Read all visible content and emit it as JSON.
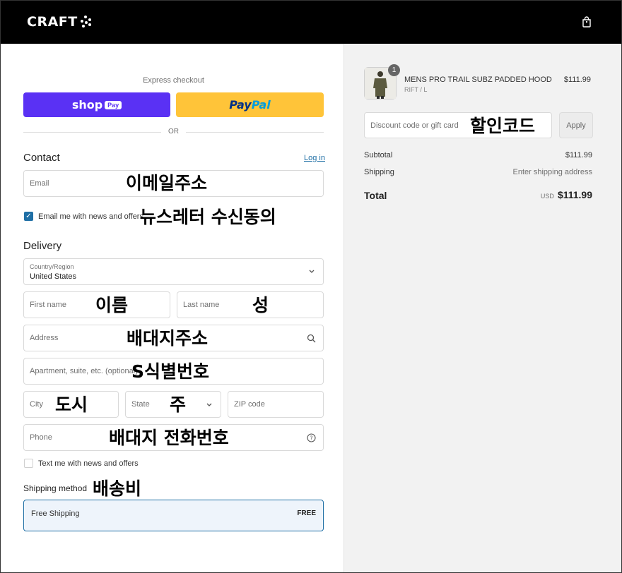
{
  "header": {
    "logo": "CRAFT",
    "bag_icon": "shopping-bag-icon"
  },
  "express": {
    "label": "Express checkout",
    "shop_pay": {
      "shop": "shop",
      "pay": "Pay",
      "color": "#5a31f4"
    },
    "paypal": {
      "p1": "Pay",
      "p2": "Pal",
      "color": "#ffc439"
    },
    "or": "OR"
  },
  "contact": {
    "title": "Contact",
    "login": "Log in",
    "email_placeholder": "Email",
    "email_note": "이메일주소",
    "newsletter_label": "Email me with news and offers",
    "newsletter_checked": true,
    "newsletter_note": "뉴스레터 수신동의"
  },
  "delivery": {
    "title": "Delivery",
    "country_label": "Country/Region",
    "country_value": "United States",
    "first_name": "First name",
    "first_name_note": "이름",
    "last_name": "Last name",
    "last_name_note": "성",
    "address": "Address",
    "address_note": "배대지주소",
    "apartment": "Apartment, suite, etc. (optional)",
    "apartment_note": "S식별번호",
    "city": "City",
    "city_note": "도시",
    "state": "State",
    "state_note": "주",
    "zip": "ZIP code",
    "phone": "Phone",
    "phone_note": "배대지 전화번호",
    "text_label": "Text me with news and offers",
    "text_checked": false
  },
  "shipping": {
    "title": "Shipping method",
    "note": "배송비",
    "option_name": "Free Shipping",
    "option_price": "FREE"
  },
  "summary": {
    "product_name": "MENS PRO TRAIL SUBZ PADDED HOOD",
    "product_variant": "RIFT / L",
    "product_price": "$111.99",
    "quantity": "1",
    "discount_placeholder": "Discount code or gift card",
    "discount_note": "할인코드",
    "apply": "Apply",
    "subtotal_label": "Subtotal",
    "subtotal_value": "$111.99",
    "shipping_label": "Shipping",
    "shipping_value": "Enter shipping address",
    "total_label": "Total",
    "currency": "USD",
    "total_value": "$111.99"
  }
}
